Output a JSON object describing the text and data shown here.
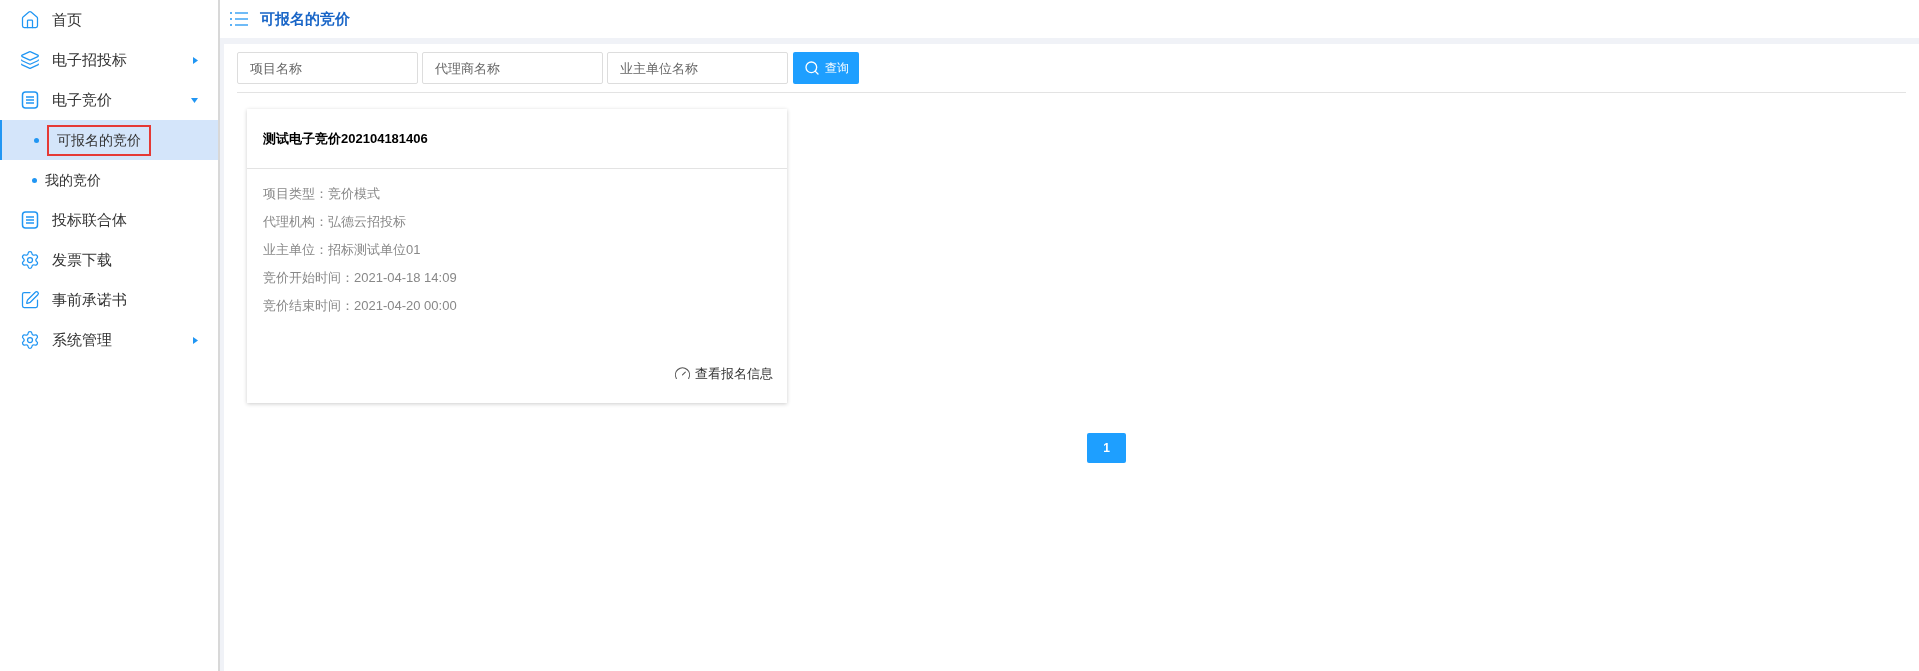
{
  "sidebar": {
    "items": [
      {
        "label": "首页"
      },
      {
        "label": "电子招投标",
        "expanded": false
      },
      {
        "label": "电子竞价",
        "expanded": true,
        "children": [
          {
            "label": "可报名的竞价",
            "selected": true
          },
          {
            "label": "我的竞价",
            "selected": false
          }
        ]
      },
      {
        "label": "投标联合体"
      },
      {
        "label": "发票下载"
      },
      {
        "label": "事前承诺书"
      },
      {
        "label": "系统管理",
        "expanded": false
      }
    ]
  },
  "page_title": "可报名的竞价",
  "search": {
    "fields": [
      {
        "placeholder": "项目名称"
      },
      {
        "placeholder": "代理商名称"
      },
      {
        "placeholder": "业主单位名称"
      }
    ],
    "button": "查询"
  },
  "cards": [
    {
      "title": "测试电子竞价202104181406",
      "details": [
        "项目类型：竞价模式",
        "代理机构：弘德云招投标",
        "业主单位：招标测试单位01",
        "竞价开始时间：2021-04-18 14:09",
        "竞价结束时间：2021-04-20 00:00"
      ],
      "action": "查看报名信息"
    }
  ],
  "pagination": [
    {
      "label": "1",
      "selected": true
    }
  ]
}
